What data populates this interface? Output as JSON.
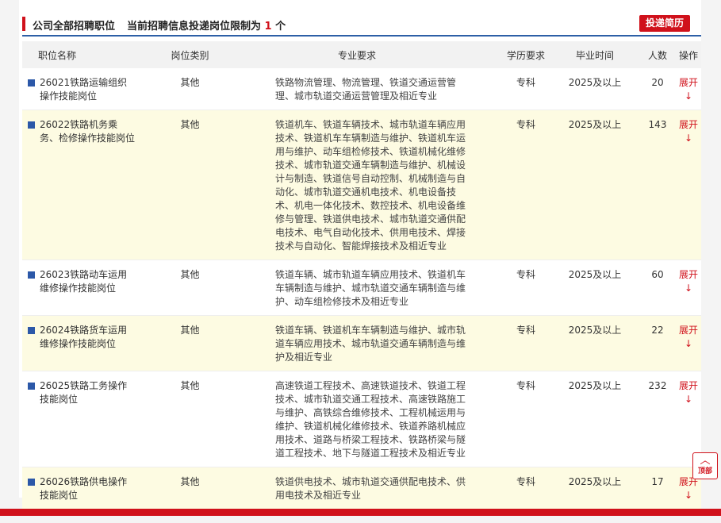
{
  "header": {
    "title": "公司全部招聘职位",
    "limit_prefix": "当前招聘信息投递岗位限制为",
    "limit_count": "1",
    "limit_suffix": "个",
    "submit_label": "投递简历"
  },
  "columns": [
    "职位名称",
    "岗位类别",
    "专业要求",
    "学历要求",
    "毕业时间",
    "人数",
    "操作"
  ],
  "rows": [
    {
      "name": "26021铁路运输组织操作技能岗位",
      "category": "其他",
      "major": "铁路物流管理、物流管理、铁道交通运营管理、城市轨道交通运营管理及相近专业",
      "education": "专科",
      "graduation": "2025及以上",
      "count": "20",
      "action": "展开↓"
    },
    {
      "name": "26022铁路机务乘务、检修操作技能岗位",
      "category": "其他",
      "major": "铁道机车、铁道车辆技术、城市轨道车辆应用技术、铁道机车车辆制造与维护、铁道机车运用与维护、动车组检修技术、铁道机械化维修技术、城市轨道交通车辆制造与维护、机械设计与制造、铁道信号自动控制、机械制造与自动化、城市轨道交通机电技术、机电设备技术、机电一体化技术、数控技术、机电设备维修与管理、铁道供电技术、城市轨道交通供配电技术、电气自动化技术、供用电技术、焊接技术与自动化、智能焊接技术及相近专业",
      "education": "专科",
      "graduation": "2025及以上",
      "count": "143",
      "action": "展开↓"
    },
    {
      "name": "26023铁路动车运用维修操作技能岗位",
      "category": "其他",
      "major": "铁道车辆、城市轨道车辆应用技术、铁道机车车辆制造与维护、城市轨道交通车辆制造与维护、动车组检修技术及相近专业",
      "education": "专科",
      "graduation": "2025及以上",
      "count": "60",
      "action": "展开↓"
    },
    {
      "name": "26024铁路货车运用维修操作技能岗位",
      "category": "其他",
      "major": "铁道车辆、铁道机车车辆制造与维护、城市轨道车辆应用技术、城市轨道交通车辆制造与维护及相近专业",
      "education": "专科",
      "graduation": "2025及以上",
      "count": "22",
      "action": "展开↓"
    },
    {
      "name": "26025铁路工务操作技能岗位",
      "category": "其他",
      "major": "高速铁道工程技术、高速铁道技术、铁道工程技术、城市轨道交通工程技术、高速铁路施工与维护、高铁综合维修技术、工程机械运用与维护、铁道机械化维修技术、铁道养路机械应用技术、道路与桥梁工程技术、铁路桥梁与隧道工程技术、地下与隧道工程技术及相近专业",
      "education": "专科",
      "graduation": "2025及以上",
      "count": "232",
      "action": "展开↓"
    },
    {
      "name": "26026铁路供电操作技能岗位",
      "category": "其他",
      "major": "铁道供电技术、城市轨道交通供配电技术、供用电技术及相近专业",
      "education": "专科",
      "graduation": "2025及以上",
      "count": "17",
      "action": "展开↓"
    }
  ],
  "back_to_top": {
    "label": "顶部"
  }
}
